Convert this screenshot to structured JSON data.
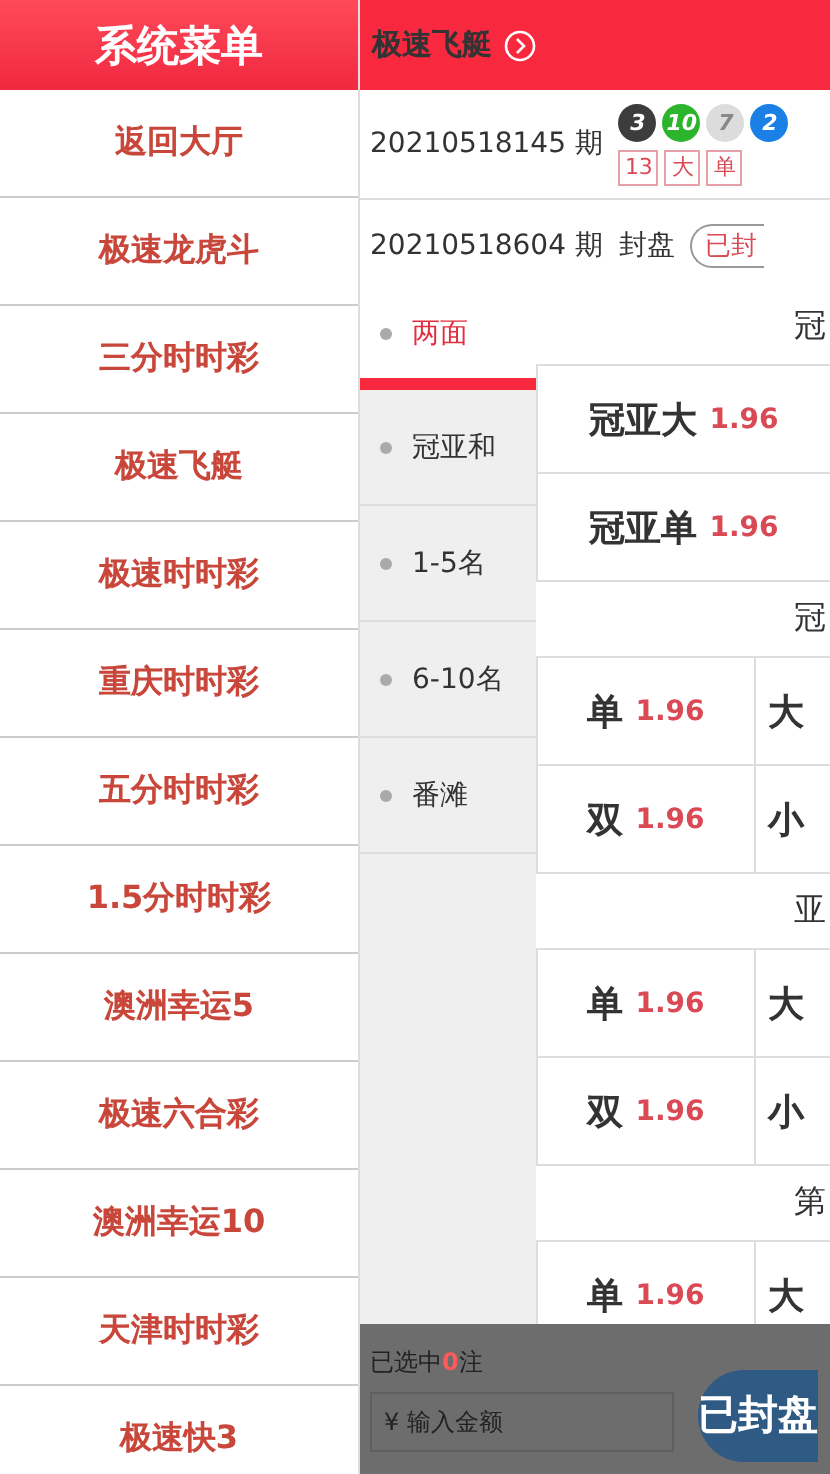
{
  "menu": {
    "title": "系统菜单",
    "items": [
      {
        "label": "返回大厅"
      },
      {
        "label": "极速龙虎斗"
      },
      {
        "label": "三分时时彩"
      },
      {
        "label": "极速飞艇"
      },
      {
        "label": "极速时时彩"
      },
      {
        "label": "重庆时时彩"
      },
      {
        "label": "五分时时彩"
      },
      {
        "label": "1.5分时时彩"
      },
      {
        "label": "澳洲幸运5"
      },
      {
        "label": "极速六合彩"
      },
      {
        "label": "澳洲幸运10"
      },
      {
        "label": "天津时时彩"
      },
      {
        "label": "极速快3"
      }
    ]
  },
  "game": {
    "title": "极速飞艇",
    "last_draw": {
      "issue": "20210518145 期",
      "balls": [
        {
          "number": "3",
          "color": "#3c3c3c"
        },
        {
          "number": "10",
          "color": "#2cb52c"
        },
        {
          "number": "7",
          "color": "#dcdcdc"
        },
        {
          "number": "2",
          "color": "#1a80e6"
        }
      ],
      "tags": [
        "13",
        "大",
        "单"
      ]
    },
    "current": {
      "issue": "20210518604 期",
      "status": "封盘",
      "badge": "已封"
    }
  },
  "tabs": [
    {
      "label": "两面",
      "selected": true
    },
    {
      "label": "冠亚和",
      "selected": false
    },
    {
      "label": "1-5名",
      "selected": false
    },
    {
      "label": "6-10名",
      "selected": false
    },
    {
      "label": "番滩",
      "selected": false
    }
  ],
  "sections": [
    {
      "title": "冠",
      "rows": [
        [
          {
            "name": "冠亚大",
            "odds": "1.96"
          }
        ],
        [
          {
            "name": "冠亚单",
            "odds": "1.96"
          }
        ]
      ]
    },
    {
      "title": "冠",
      "rows": [
        [
          {
            "name": "单",
            "odds": "1.96"
          },
          {
            "name": "大"
          }
        ],
        [
          {
            "name": "双",
            "odds": "1.96"
          },
          {
            "name": "小"
          }
        ]
      ]
    },
    {
      "title": "亚",
      "rows": [
        [
          {
            "name": "单",
            "odds": "1.96"
          },
          {
            "name": "大"
          }
        ],
        [
          {
            "name": "双",
            "odds": "1.96"
          },
          {
            "name": "小"
          }
        ]
      ]
    },
    {
      "title": "第",
      "rows": [
        [
          {
            "name": "单",
            "odds": "1.96"
          },
          {
            "name": "大"
          }
        ]
      ]
    }
  ],
  "bet_bar": {
    "selected_prefix": "已选中",
    "count": "0",
    "suffix": "注",
    "amount_placeholder": "¥ 输入金额",
    "submit": "已封盘"
  }
}
